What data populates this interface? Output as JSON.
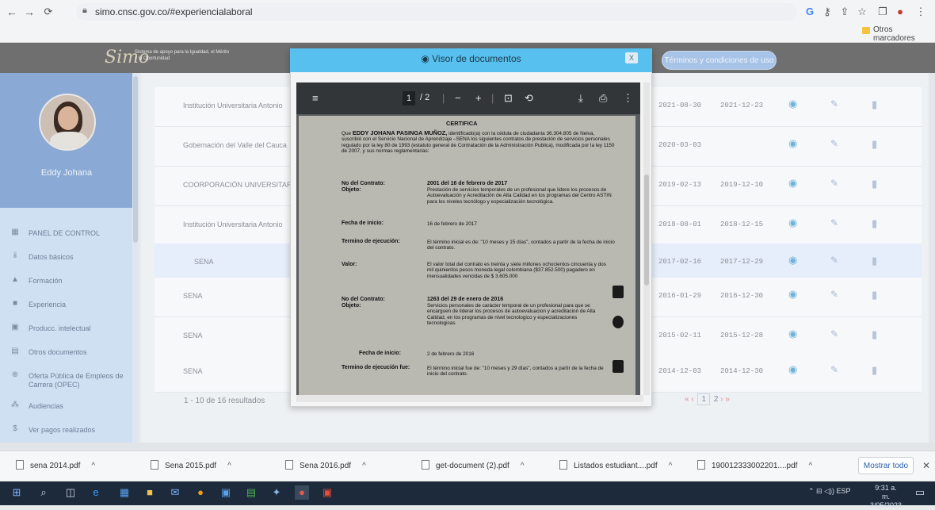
{
  "browser": {
    "url": "simo.cnsc.gov.co/#experiencialaboral",
    "bookmarks_label": "Otros marcadores",
    "icons": [
      "back-icon",
      "forward-icon",
      "reload-icon",
      "lock-icon",
      "google-icon",
      "key-icon",
      "share-icon",
      "star-icon",
      "window-icon",
      "profile-icon",
      "menu-icon"
    ]
  },
  "app": {
    "logo_text": "Simo",
    "logo_tagline": "Sistema de apoyo para la Igualdad, el Mérito y la Oportunidad",
    "terms_button": "Términos y condiciones de uso"
  },
  "sidebar": {
    "user_name": "Eddy Johana",
    "items": [
      {
        "label": "PANEL DE CONTROL",
        "icon": "dashboard-icon"
      },
      {
        "label": "Datos básicos",
        "icon": "users-icon"
      },
      {
        "label": "Formación",
        "icon": "graduation-icon"
      },
      {
        "label": "Experiencia",
        "icon": "briefcase-icon"
      },
      {
        "label": "Producc. intelectual",
        "icon": "book-icon"
      },
      {
        "label": "Otros documentos",
        "icon": "document-icon"
      },
      {
        "label": "Oferta Pública de Empleos de Carrera (OPEC)",
        "icon": "globe-icon"
      },
      {
        "label": "Audiencias",
        "icon": "audience-icon"
      },
      {
        "label": "Ver pagos realizados",
        "icon": "dollar-icon"
      }
    ]
  },
  "table": {
    "rows": [
      {
        "entity": "Institución Universitaria Antonio",
        "start": "2021-08-30",
        "end": "2021-12-23"
      },
      {
        "entity": "Gobernación del Valle del Cauca",
        "start": "2020-03-03",
        "end": ""
      },
      {
        "entity": "COORPORACIÓN UNIVERSITARI",
        "start": "2019-02-13",
        "end": "2019-12-10"
      },
      {
        "entity": "Institución Universitaria Antonio",
        "start": "2018-08-01",
        "end": "2018-12-15"
      },
      {
        "entity": "SENA",
        "start": "2017-02-16",
        "end": "2017-12-29"
      },
      {
        "entity": "SENA",
        "start": "2016-01-29",
        "end": "2016-12-30"
      },
      {
        "entity": "SENA",
        "start": "2015-02-11",
        "end": "2015-12-28"
      },
      {
        "entity": "SENA",
        "start": "2014-12-03",
        "end": "2014-12-30"
      }
    ],
    "results_text": "1 - 10 de 16 resultados",
    "pager": {
      "first": "«",
      "prev": "‹",
      "current": "1",
      "next_page": "2",
      "next": "›",
      "last": "»"
    }
  },
  "viewer": {
    "title": "Visor de documentos",
    "close_label": "X",
    "page_current": "1",
    "page_total": "/ 2",
    "doc": {
      "heading": "CERTIFICA",
      "intro_a": "Que",
      "intro_name": "EDDY JOHANA PASINGA MUÑOZ,",
      "intro_b": "identificado(a) con la cédula de ciudadanía 36.304.805 de Neiva, suscribió con el Servicio Nacional de Aprendizaje –SENA los siguientes contratos de prestación de servicios personales regulado por la ley 80 de 1993 (estatuto general de Contratación de la Administración Publica), modificada por la ley 1150 de 2007, y sus normas reglamentarias:",
      "no_contrato_label": "No del Contrato:",
      "objeto_label": "Objeto:",
      "c1_no": "2001 del 16 de febrero de 2017",
      "c1_obj": "Prestación de servicios temporales de un profesional que lidere los procesos de Autoevaluación y Acreditación de Alta Calidad en los programas del Centro ASTIN para los niveles tecnólogo y especialización tecnológica.",
      "fecha_label": "Fecha de inicio:",
      "c1_fecha": "16 de febrero de 2017",
      "termino_label": "Termino de ejecución:",
      "c1_term": "El término inicial es de: \"10 meses y 15 días\", contados a partir de la fecha de inicio del contrato.",
      "valor_label": "Valor:",
      "c1_valor": "El valor total del contrato es treinta y siete millones ochocientos cincuenta y dos mil quinientos pesos moneda legal colombiana ($37.852.500) pagadero en mensualidades vencidas de $ 3.605.000",
      "c2_no": "1263 del 29 de enero de 2016",
      "c2_obj": "Servicios personales de carácter temporal de un profesional para que se encarguen de liderar los procesos de autoevaluacion y acreditacion de Alta Calidad, en los programas de nivel tecnologico y especializaciones tecnologicas",
      "c2_fecha": "2 de febrero de 2016",
      "termino2_label": "Termino de ejecución fue:",
      "c2_term": "El término inicial fue de: \"10 meses y 29 días\", contados a partir de la fecha de inicio del contrato."
    }
  },
  "downloads": {
    "items": [
      "sena 2014.pdf",
      "Sena 2015.pdf",
      "Sena 2016.pdf",
      "get-document (2).pdf",
      "Listados estudiant....pdf",
      "190012333002201....pdf"
    ],
    "show_all": "Mostrar todo",
    "close": "✕"
  },
  "taskbar": {
    "lang": "ESP",
    "time": "9:31 a. m.",
    "date": "3/05/2023"
  }
}
